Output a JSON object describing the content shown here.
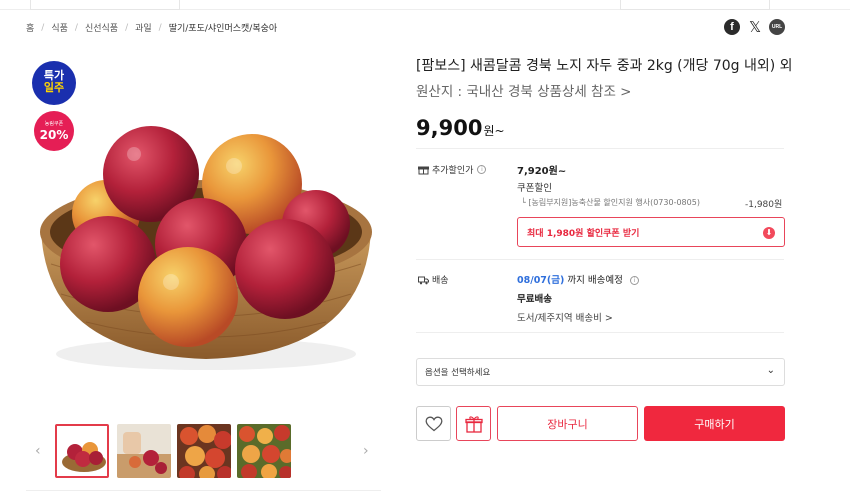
{
  "breadcrumb": [
    "홈",
    "식품",
    "신선식품",
    "과일",
    "딸기/포도/샤인머스캣/복숭아"
  ],
  "share": {
    "facebook_icon": "f",
    "x_icon": "𝕏",
    "url_icon": "URL"
  },
  "badges": {
    "sale_line1": "특가",
    "sale_line2": "일주",
    "coupon_small": "농림쿠폰",
    "coupon_big": "20%"
  },
  "product": {
    "title": "[팜보스] 새콤달콤 경북 노지 자두 중과 2kg (개당 70g 내외) 외",
    "origin": "원산지 : 국내산 경북 상품상세 참조 >",
    "price": "9,900",
    "price_unit": "원~"
  },
  "discount": {
    "label": "추가할인가",
    "info": "i",
    "price": "7,920원~",
    "coupon_label": "쿠폰할인",
    "coupon_detail": "[농림부지원]농축산물 할인지원 행사(0730-0805)",
    "coupon_amount": "-1,980원",
    "coupon_button": "최대 1,980원 할인쿠폰 받기"
  },
  "shipping": {
    "label": "배송",
    "date": "08/07(금)",
    "date_suffix": " 까지 배송예정",
    "free": "무료배송",
    "island": "도서/제주지역 배송비 >"
  },
  "option": {
    "placeholder": "옵션을 선택하세요"
  },
  "actions": {
    "cart": "장바구니",
    "buy": "구매하기"
  },
  "colors": {
    "accent": "#f0283e",
    "badge_blue": "#1a2fae",
    "badge_pink": "#e51e55",
    "ship_blue": "#2f6fdc"
  }
}
